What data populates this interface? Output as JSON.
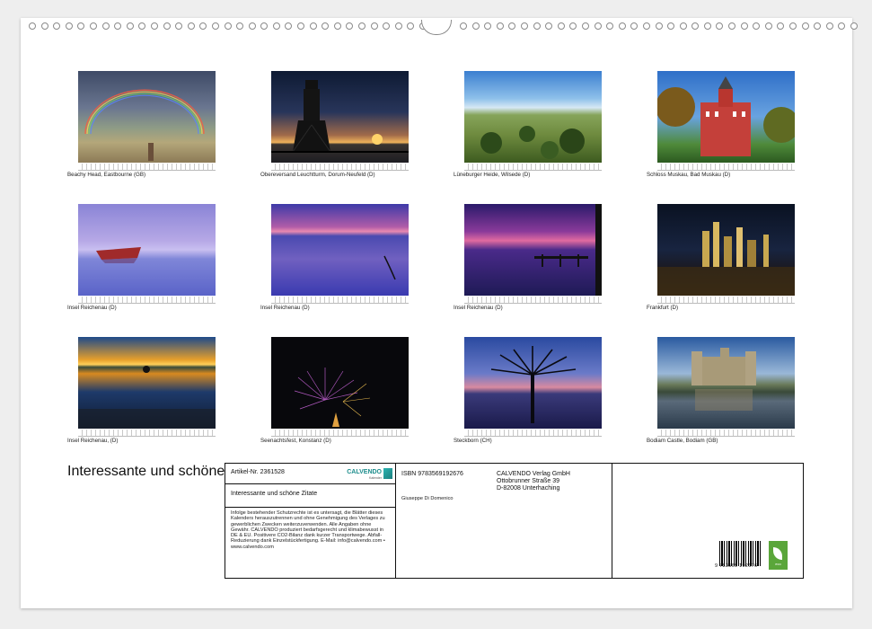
{
  "calendar": {
    "title": "Interessante und schöne Zitate",
    "thumbnails": [
      {
        "caption": "Beachy Head, Eastbourne (GB)",
        "scene": "rainbow"
      },
      {
        "caption": "Obereversand Leuchtturm, Dorum-Neufeld (D)",
        "scene": "lighthouse"
      },
      {
        "caption": "Lüneburger Heide, Wilsede (D)",
        "scene": "heath"
      },
      {
        "caption": "Schloss Muskau, Bad Muskau (D)",
        "scene": "castle"
      },
      {
        "caption": "Insel Reichenau  (D)",
        "scene": "boat"
      },
      {
        "caption": "Insel Reichenau  (D)",
        "scene": "lake-violet"
      },
      {
        "caption": "Insel Reichenau  (D)",
        "scene": "jetty"
      },
      {
        "caption": "Frankfurt (D)",
        "scene": "city"
      },
      {
        "caption": "Insel Reichenau, (D)",
        "scene": "sunset"
      },
      {
        "caption": "Seenachtsfest, Konstanz (D)",
        "scene": "fireworks"
      },
      {
        "caption": "Steckborn (CH)",
        "scene": "tree"
      },
      {
        "caption": "Bodiam Castle, Bodiam (GB)",
        "scene": "bodiam"
      }
    ]
  },
  "info": {
    "article": "Artikel-Nr. 2361528",
    "calendar_title": "Interessante und schöne Zitate",
    "legal": "Infolge bestehender Schutzrechte ist es untersagt, die Blätter dieses Kalenders herauszutrennen und ohne Genehmigung des Verlages zu gewerblichen Zwecken weiterzuverwenden. Alle Angaben ohne Gewähr. CALVENDO produziert bedarfsgerecht und klimabewusst in DE & EU. Positivere CO2-Bilanz dank kurzer Transportwege. Abfall-Reduzierung dank Einzelstückfertigung. E-Mail: info@calvendo.com • www.calvendo.com",
    "isbn": "ISBN 9783569192676",
    "author": "Giuseppe Di Domenico",
    "publisher_name": "CALVENDO Verlag GmbH",
    "publisher_street": "Ottobrunner Straße 39",
    "publisher_city": "D-82008 Unterhaching",
    "barcode_number": "9 783569 192676",
    "logo_text": "CALVENDO",
    "logo_sub": "Kalender",
    "eco_label": "eco"
  }
}
